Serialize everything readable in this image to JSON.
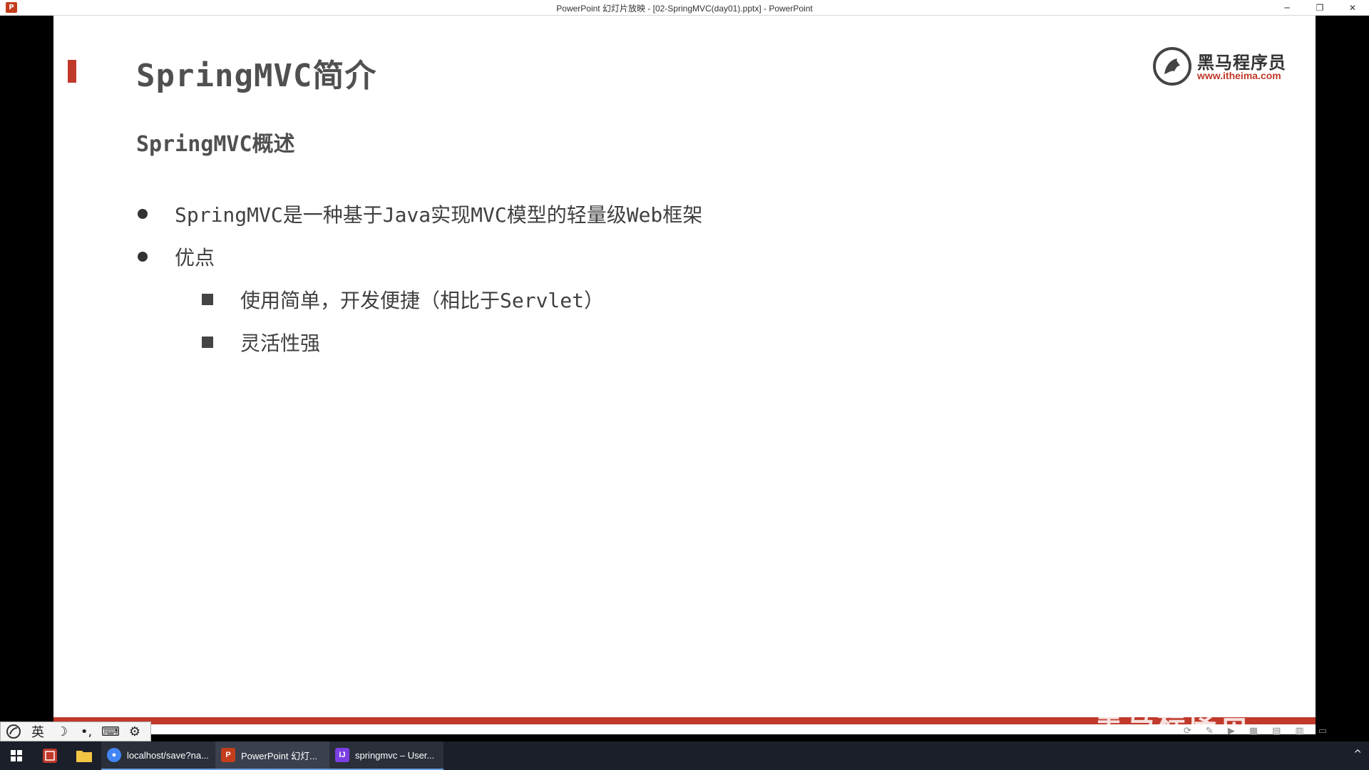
{
  "window": {
    "title": "PowerPoint 幻灯片放映 - [02-SpringMVC(day01).pptx] - PowerPoint",
    "app_icon": "P",
    "controls": {
      "minimize": "─",
      "restore": "❐",
      "close": "✕"
    }
  },
  "slide": {
    "title": "SpringMVC简介",
    "subtitle": "SpringMVC概述",
    "logo": {
      "name": "黑马程序员",
      "url": "www.itheima.com"
    },
    "bullets": [
      {
        "text": "SpringMVC是一种基于Java实现MVC模型的轻量级Web框架"
      },
      {
        "text": "优点"
      }
    ],
    "sub_bullets": [
      {
        "text": "使用简单，开发便捷（相比于Servlet）"
      },
      {
        "text": "灵活性强"
      }
    ],
    "watermark": "黑马程序员",
    "accent_color": "#c0392b"
  },
  "ime": {
    "items": [
      "英",
      "☽",
      "•,",
      "⌨",
      "⚙"
    ]
  },
  "taskbar": {
    "items": [
      {
        "label": "localhost/save?na...",
        "icon": "chrome-icon"
      },
      {
        "label": "PowerPoint 幻灯...",
        "icon": "powerpoint-icon"
      },
      {
        "label": "springmvc – User...",
        "icon": "intellij-icon"
      }
    ],
    "tray_chevron": "^"
  }
}
